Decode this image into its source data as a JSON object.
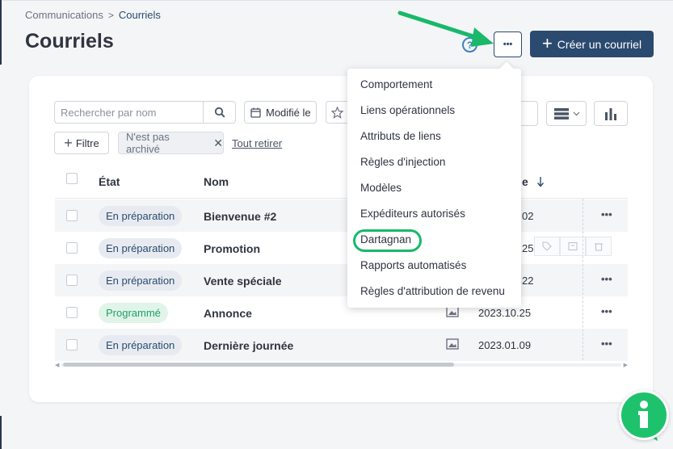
{
  "breadcrumb": {
    "parent": "Communications",
    "separator": ">",
    "current": "Courriels"
  },
  "page": {
    "title": "Courriels"
  },
  "header": {
    "help_symbol": "?",
    "more_symbol": "•••",
    "create_label": "Créer un courriel",
    "create_symbol": "+"
  },
  "toolbar": {
    "search_placeholder": "Rechercher par nom",
    "date_label": "Modifié le",
    "filter_label": "Filtre",
    "chip_label": "N'est pas archivé",
    "clear_all_label": "Tout retirer"
  },
  "table": {
    "headers": {
      "state": "État",
      "name": "Nom",
      "date_partial": "e"
    },
    "rows": [
      {
        "state": "En préparation",
        "name": "Bienvenue #2",
        "date": "02"
      },
      {
        "state": "En préparation",
        "name": "Promotion",
        "date": "25"
      },
      {
        "state": "En préparation",
        "name": "Vente spéciale",
        "date": "22"
      },
      {
        "state": "Programmé",
        "name": "Annonce",
        "date": "2023.10.25"
      },
      {
        "state": "En préparation",
        "name": "Dernière journée",
        "date": "2023.01.09"
      }
    ]
  },
  "menu": {
    "items": [
      "Comportement",
      "Liens opérationnels",
      "Attributs de liens",
      "Règles d'injection",
      "Modèles",
      "Expéditeurs autorisés",
      "Dartagnan",
      "Rapports automatisés",
      "Règles d'attribution de revenu"
    ],
    "highlighted": "Dartagnan"
  },
  "colors": {
    "primary": "#2b4a6f",
    "annotation_green": "#19b86a",
    "prep_badge_bg": "#e7ebf1",
    "prog_badge_fg": "#22a062"
  },
  "icons": [
    "search-icon",
    "calendar-icon",
    "star-icon",
    "list-view-icon",
    "chart-icon",
    "image-icon",
    "tag-icon",
    "archive-icon",
    "trash-icon",
    "info-icon",
    "sort-desc-icon"
  ]
}
